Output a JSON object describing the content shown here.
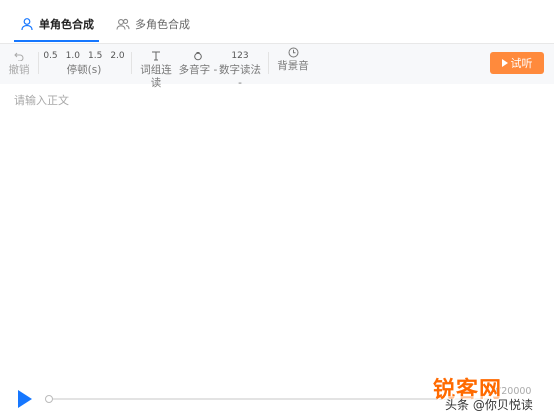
{
  "tabs": [
    {
      "label": "单角色合成",
      "icon": "user-icon",
      "active": true
    },
    {
      "label": "多角色合成",
      "icon": "users-icon",
      "active": false
    }
  ],
  "toolbar": {
    "undo": {
      "icon": "undo-icon",
      "label": "撤销"
    },
    "pause": {
      "values": [
        "0.5",
        "1.0",
        "1.5",
        "2.0"
      ],
      "label": "停顿(s)"
    },
    "word_group": {
      "icon": "text-cursor-icon",
      "label": "词组连读"
    },
    "polyphone": {
      "icon": "polyphone-icon",
      "label": "多音字 -"
    },
    "number": {
      "icon_text": "123",
      "label": "数字读法 -"
    },
    "bgm": {
      "icon": "music-icon",
      "label": "背景音"
    },
    "try_label": "试听"
  },
  "editor": {
    "placeholder": "请输入正文",
    "value": ""
  },
  "player": {
    "count": "0/20000",
    "progress": 0
  },
  "watermark": {
    "logo": "锐客网",
    "text": "头条 @你贝悦读"
  },
  "colors": {
    "accent": "#1677ff",
    "try_button": "#ff8a3c",
    "watermark": "#ff6a00"
  }
}
